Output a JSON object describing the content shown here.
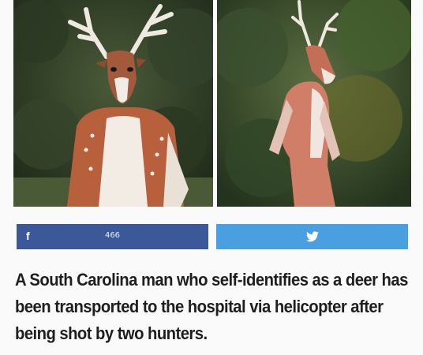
{
  "images": {
    "left": {
      "icon": "deer-costume-photo"
    },
    "right": {
      "icon": "deer-costume-photo"
    }
  },
  "share": {
    "facebook": {
      "icon": "facebook-icon",
      "count": "466",
      "color": "#3b5998"
    },
    "twitter": {
      "icon": "twitter-icon",
      "color": "#4a9fe0"
    }
  },
  "headline": "A South Carolina man who self-identifies as a deer has been transported to the hospital via helicopter after being shot by two hunters."
}
